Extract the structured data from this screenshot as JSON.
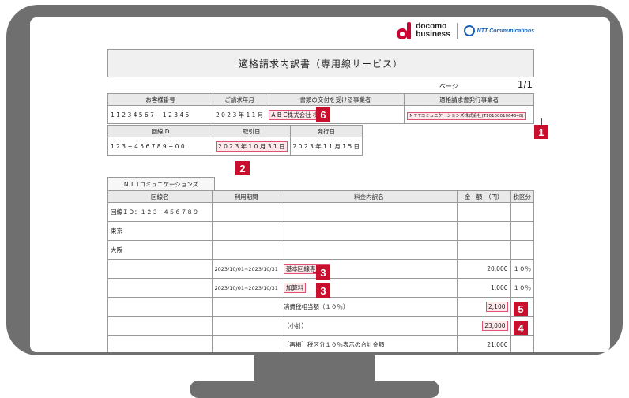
{
  "logo": {
    "brand_top": "docomo",
    "brand_bottom": "business",
    "partner": "NTT Communications"
  },
  "document": {
    "title": "適格請求内訳書（専用線サービス）",
    "page_label": "ページ",
    "page_number": "1/1"
  },
  "header_table": {
    "columns": [
      "お客様番号",
      "ご請求年月",
      "書類の交付を受ける事業者",
      "適格請求書発行事業者"
    ],
    "values": [
      "1 1 2 3 4 5 6 7 − 1 2 3 4 5",
      "2 0 2 3 年 1 1 月",
      "A B C株式会社 様",
      "N T Tコミュニケーションズ株式会社(T1010001064648)"
    ]
  },
  "line_table": {
    "columns": [
      "回線ID",
      "取引日",
      "発行日"
    ],
    "values": [
      "1 2 3 − 4 5 6 7 8 9 − 0 0",
      "2 0 2 3 年 1 0 月 3 1 日",
      "2 0 2 3 年 1 1 月 1 5 日"
    ]
  },
  "detail": {
    "section_tab": "N T Tコミュニケーションズ",
    "columns": [
      "回線名",
      "利用期間",
      "料金内訳名",
      "金　額　（円）",
      "税区分"
    ],
    "rows": [
      {
        "name": "回線ＩＤ：１２３−４５６７８９",
        "period": "",
        "item": "",
        "amount": "",
        "tax": ""
      },
      {
        "name": "東京",
        "period": "",
        "item": "",
        "amount": "",
        "tax": ""
      },
      {
        "name": "大阪",
        "period": "",
        "item": "",
        "amount": "",
        "tax": ""
      },
      {
        "name": "",
        "period": "2023/10/01~2023/10/31",
        "item": "基本回線専用料",
        "amount": "20,000",
        "tax": "１０％"
      },
      {
        "name": "",
        "period": "2023/10/01~2023/10/31",
        "item": "加算料",
        "amount": "1,000",
        "tax": "１０％"
      },
      {
        "name": "",
        "period": "",
        "item": "消費税相当額（１０％）",
        "amount": "2,100",
        "tax": ""
      },
      {
        "name": "",
        "period": "",
        "item": "（小計）",
        "amount": "23,000",
        "tax": ""
      },
      {
        "name": "",
        "period": "",
        "item": "［再掲］税区分１０％表示の合計金額",
        "amount": "21,000",
        "tax": ""
      }
    ]
  },
  "badges": [
    "1",
    "2",
    "3",
    "3",
    "4",
    "5",
    "6"
  ],
  "colors": {
    "accent": "#c8102e",
    "highlight": "#fde8ec",
    "bezel": "#6f6f6f"
  }
}
